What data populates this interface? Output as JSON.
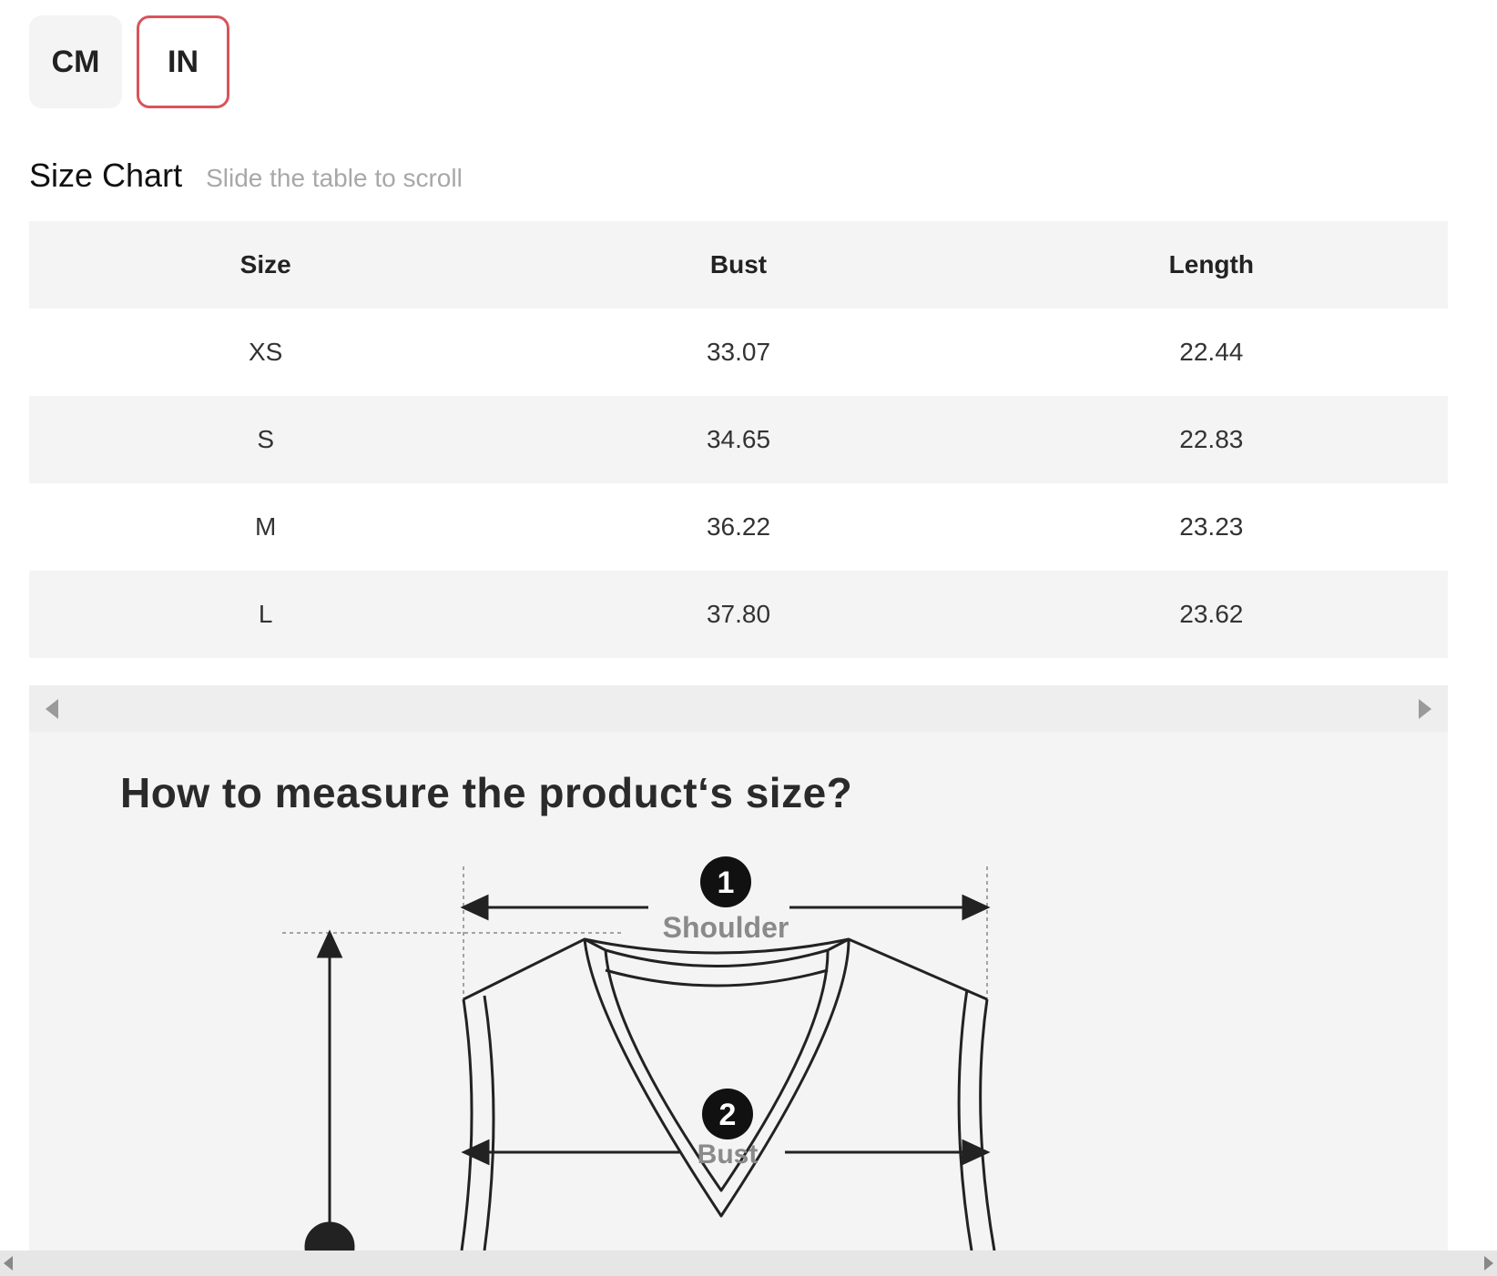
{
  "units": {
    "options": [
      {
        "label": "CM",
        "active": false
      },
      {
        "label": "IN",
        "active": true
      }
    ]
  },
  "size_chart": {
    "title": "Size Chart",
    "hint": "Slide the table to scroll",
    "columns": [
      "Size",
      "Bust",
      "Length"
    ],
    "rows": [
      {
        "size": "XS",
        "bust": "33.07",
        "length": "22.44"
      },
      {
        "size": "S",
        "bust": "34.65",
        "length": "22.83"
      },
      {
        "size": "M",
        "bust": "36.22",
        "length": "23.23"
      },
      {
        "size": "L",
        "bust": "37.80",
        "length": "23.62"
      }
    ]
  },
  "measure_guide": {
    "title": "How to measure the product‘s size?",
    "markers": [
      {
        "number": "1",
        "label": "Shoulder"
      },
      {
        "number": "2",
        "label": "Bust"
      }
    ]
  },
  "colors": {
    "active_border": "#d9535a",
    "row_shade": "#f4f4f4",
    "hint_text": "#a8a8a8"
  }
}
